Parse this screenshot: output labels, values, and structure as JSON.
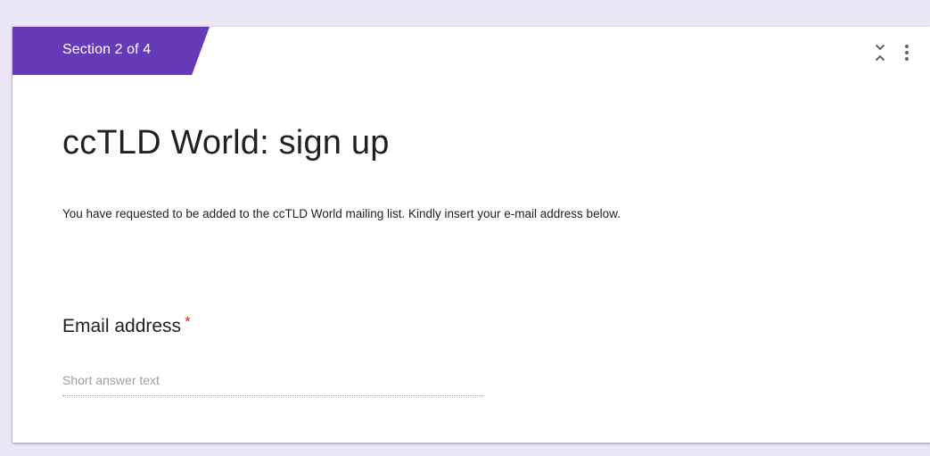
{
  "section": {
    "label": "Section 2 of 4",
    "accent_color": "#673ab7"
  },
  "toolbar": {
    "collapse_icon": "unfold-less-icon",
    "more_icon": "more-vert-icon"
  },
  "form": {
    "title": "ccTLD World: sign up",
    "description": "You have requested to be added to the ccTLD World mailing list. Kindly insert your e-mail address below."
  },
  "question": {
    "title": "Email address",
    "required_marker": "*",
    "answer_placeholder": "Short answer text"
  }
}
